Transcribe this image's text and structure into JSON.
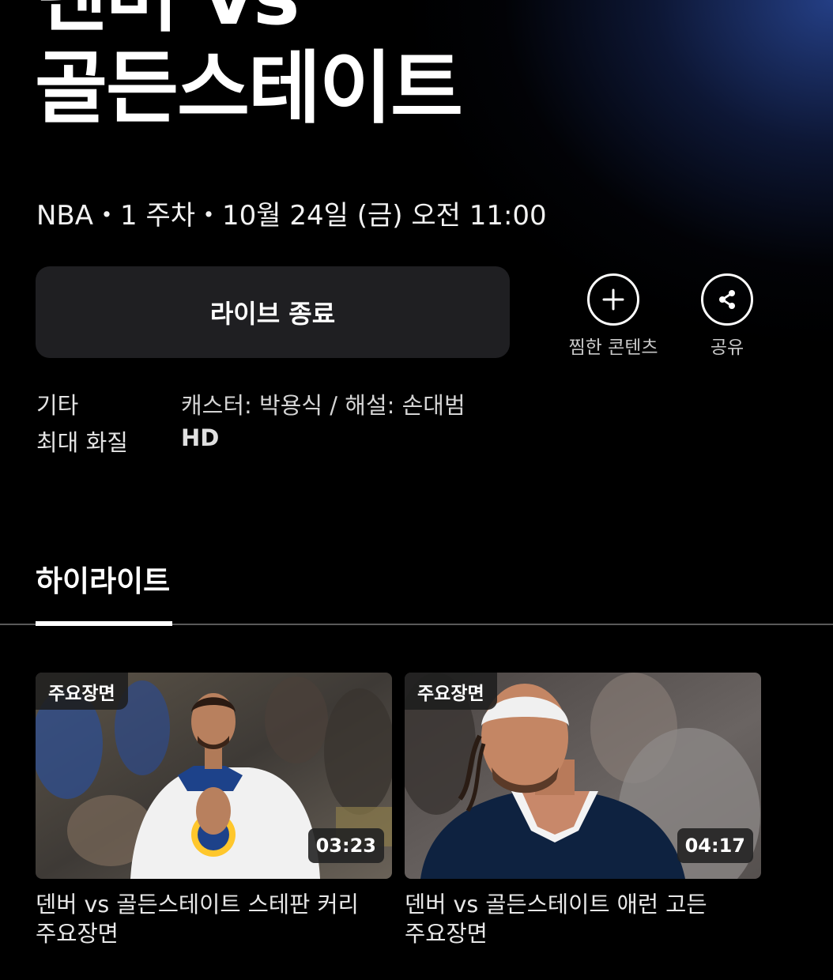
{
  "header": {
    "title_line1": "덴버 vs",
    "title_line2": "골든스테이트",
    "meta": "NBA・1 주차・10월 24일 (금) 오전 11:00"
  },
  "actions": {
    "live_button_label": "라이브 종료",
    "wishlist_label": "찜한 콘텐츠",
    "wishlist_icon": "plus-icon",
    "share_label": "공유",
    "share_icon": "share-icon"
  },
  "info": {
    "rows": [
      {
        "label": "기타",
        "value": "캐스터: 박용식 / 해설: 손대범"
      },
      {
        "label": "최대 화질",
        "value": "HD"
      }
    ]
  },
  "tabs": [
    {
      "label": "하이라이트",
      "active": true
    }
  ],
  "highlights": [
    {
      "badge": "주요장면",
      "duration": "03:23",
      "title": "덴버 vs 골든스테이트 스테판 커리 주요장면"
    },
    {
      "badge": "주요장면",
      "duration": "04:17",
      "title": "덴버 vs 골든스테이트 애런 고든 주요장면"
    }
  ],
  "colors": {
    "background": "#000000",
    "button_bg": "#1f1f22",
    "glow": "#26428c",
    "warriors_blue": "#1d428a",
    "nuggets_navy": "#0e2240"
  }
}
